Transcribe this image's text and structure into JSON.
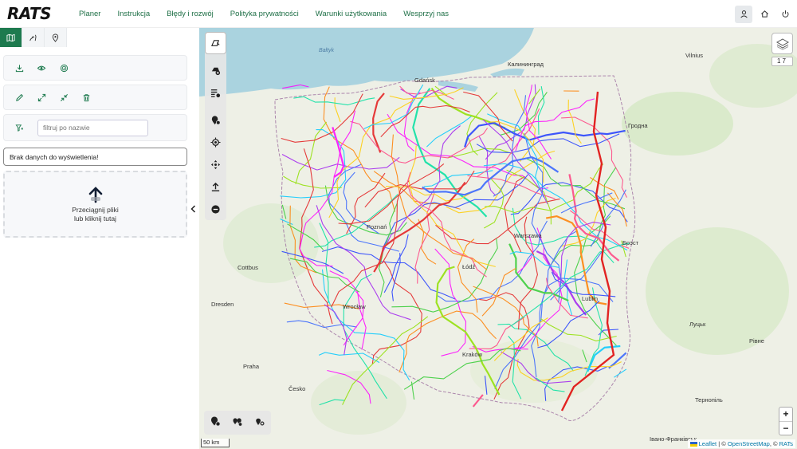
{
  "app": {
    "logo": "RATS"
  },
  "nav": {
    "items": [
      "Planer",
      "Instrukcja",
      "Błędy i rozwój",
      "Polityka prywatności",
      "Warunki użytkowania",
      "Wesprzyj nas"
    ]
  },
  "sidebar": {
    "filter": {
      "placeholder": "filtruj po nazwie"
    },
    "no_data": "Brak danych do wyświetlenia!",
    "dropzone": {
      "line1": "Przeciągnij pliki",
      "line2": "lub kliknij tutaj"
    }
  },
  "map": {
    "zoom_level": "7",
    "scale": "50 km",
    "attribution": {
      "leaflet": "Leaflet",
      "osm": "OpenStreetMap",
      "rats": "RATs",
      "sep1": " | © ",
      "sep2": ", © "
    },
    "labels": {
      "kaliningrad": "Калининград",
      "vilnius": "Vilnius",
      "gdansk": "Gdańsk",
      "grodno": "Гродна",
      "brest": "Брэст",
      "warszawa": "Warszawa",
      "wroclaw": "Wrocław",
      "dresden": "Dresden",
      "praha": "Praha",
      "cesko": "Česko",
      "lutsk": "Луцьк",
      "rivne": "Рівне",
      "ternopil": "Тернопіль",
      "ivano": "Івано-Франківськ",
      "poznan": "Poznań",
      "lodz": "Łódź",
      "krakow": "Kraków",
      "lublin": "Lublin",
      "cottbus": "Cottbus",
      "baltic": "Bałtyk"
    }
  },
  "colors": {
    "brand": "#1d7a4e",
    "nav_link": "#1e6f46"
  }
}
